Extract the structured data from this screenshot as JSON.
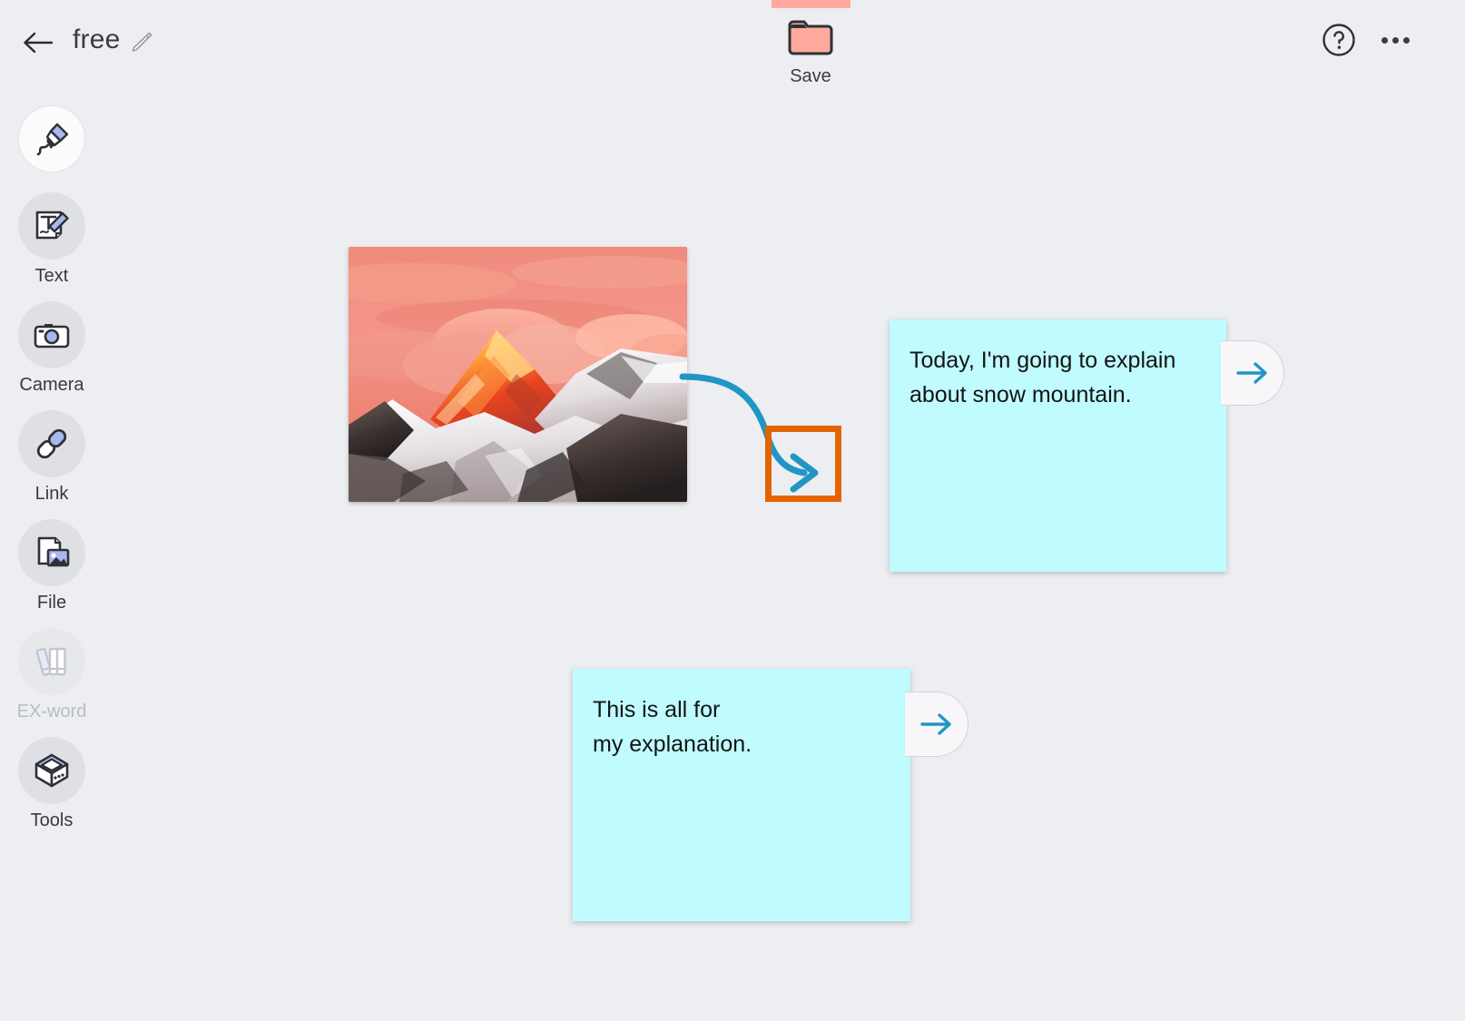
{
  "app": {
    "background_color": "#edeef2",
    "note_color": "#bffbff",
    "accent_blue": "#2196c4",
    "highlight_color": "#e36400",
    "save_folder_color": "#ffaa9c"
  },
  "topbar": {
    "back_icon": "back-arrow-icon",
    "title": "free",
    "title_edit_icon": "pencil-edit-icon",
    "save": {
      "label": "Save",
      "icon": "folder-icon"
    },
    "help_icon": "help-circle-icon",
    "more_icon": "more-horizontal-icon"
  },
  "sidebar": {
    "items": [
      {
        "label": "",
        "icon": "pen-marker-icon",
        "active": true,
        "disabled": false
      },
      {
        "label": "Text",
        "icon": "text-edit-icon",
        "active": false,
        "disabled": false
      },
      {
        "label": "Camera",
        "icon": "camera-icon",
        "active": false,
        "disabled": false
      },
      {
        "label": "Link",
        "icon": "link-chain-icon",
        "active": false,
        "disabled": false
      },
      {
        "label": "File",
        "icon": "file-image-icon",
        "active": false,
        "disabled": false
      },
      {
        "label": "EX-word",
        "icon": "books-icon",
        "active": false,
        "disabled": true
      },
      {
        "label": "Tools",
        "icon": "toolbox-cube-icon",
        "active": false,
        "disabled": false
      }
    ]
  },
  "canvas": {
    "photo": {
      "name": "snow-mountain-photo",
      "description": "Sunset-lit snow mountain peak with pink orange clouds"
    },
    "connector": {
      "name": "curved-connector-arrow",
      "color": "#2196c4"
    },
    "highlight_box": {
      "name": "arrow-highlight-box",
      "color": "#e36400"
    },
    "notes": [
      {
        "text": "Today, I'm going to explain\nabout snow mountain.",
        "tab_icon": "arrow-right-icon"
      },
      {
        "text": "This is all for\nmy explanation.",
        "tab_icon": "arrow-right-icon"
      }
    ]
  }
}
